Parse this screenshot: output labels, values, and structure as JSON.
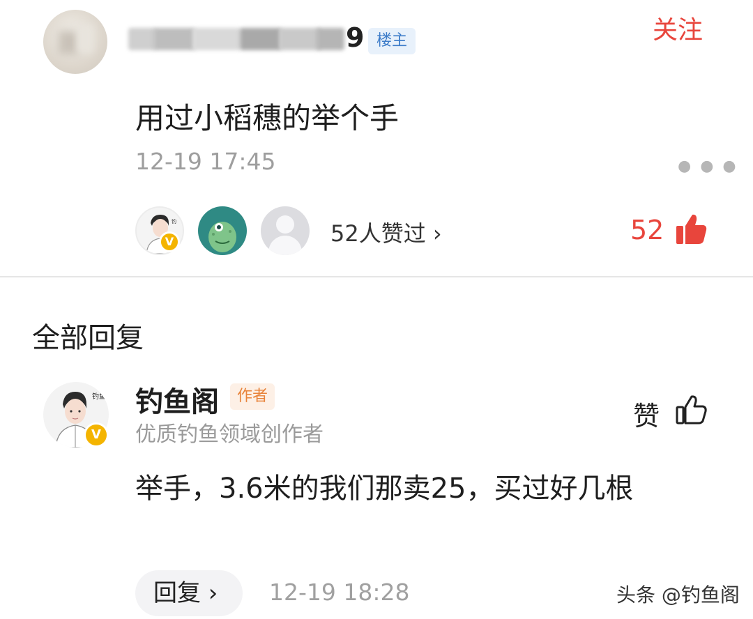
{
  "post": {
    "author_suffix": "9",
    "author_badge": "楼主",
    "follow_label": "关注",
    "text": "用过小稻穗的举个手",
    "time": "12-19 17:45",
    "more_icon": "more-dots-icon",
    "likes_text": "52人赞过 ›",
    "like_count": "52",
    "like_icon": "thumbs-up-filled-icon",
    "like_color": "#e8453c"
  },
  "replies_section": {
    "title": "全部回复"
  },
  "reply": {
    "author": "钓鱼阁",
    "author_badge": "作者",
    "author_desc": "优质钓鱼领域创作者",
    "avatar_caption": "钓鱼阁",
    "verified_mark": "V",
    "like_label": "赞",
    "like_icon": "thumbs-up-outline-icon",
    "text": "举手，3.6米的我们那卖25，买过好几根",
    "reply_button": "回复 ›",
    "time": "12-19 18:28"
  },
  "watermark": {
    "text": "头条 @钓鱼阁"
  },
  "colors": {
    "accent_red": "#e8453c",
    "verified_gold": "#f4b400",
    "op_badge_blue": "#3d7cc9",
    "author_badge_orange": "#e8833a"
  }
}
